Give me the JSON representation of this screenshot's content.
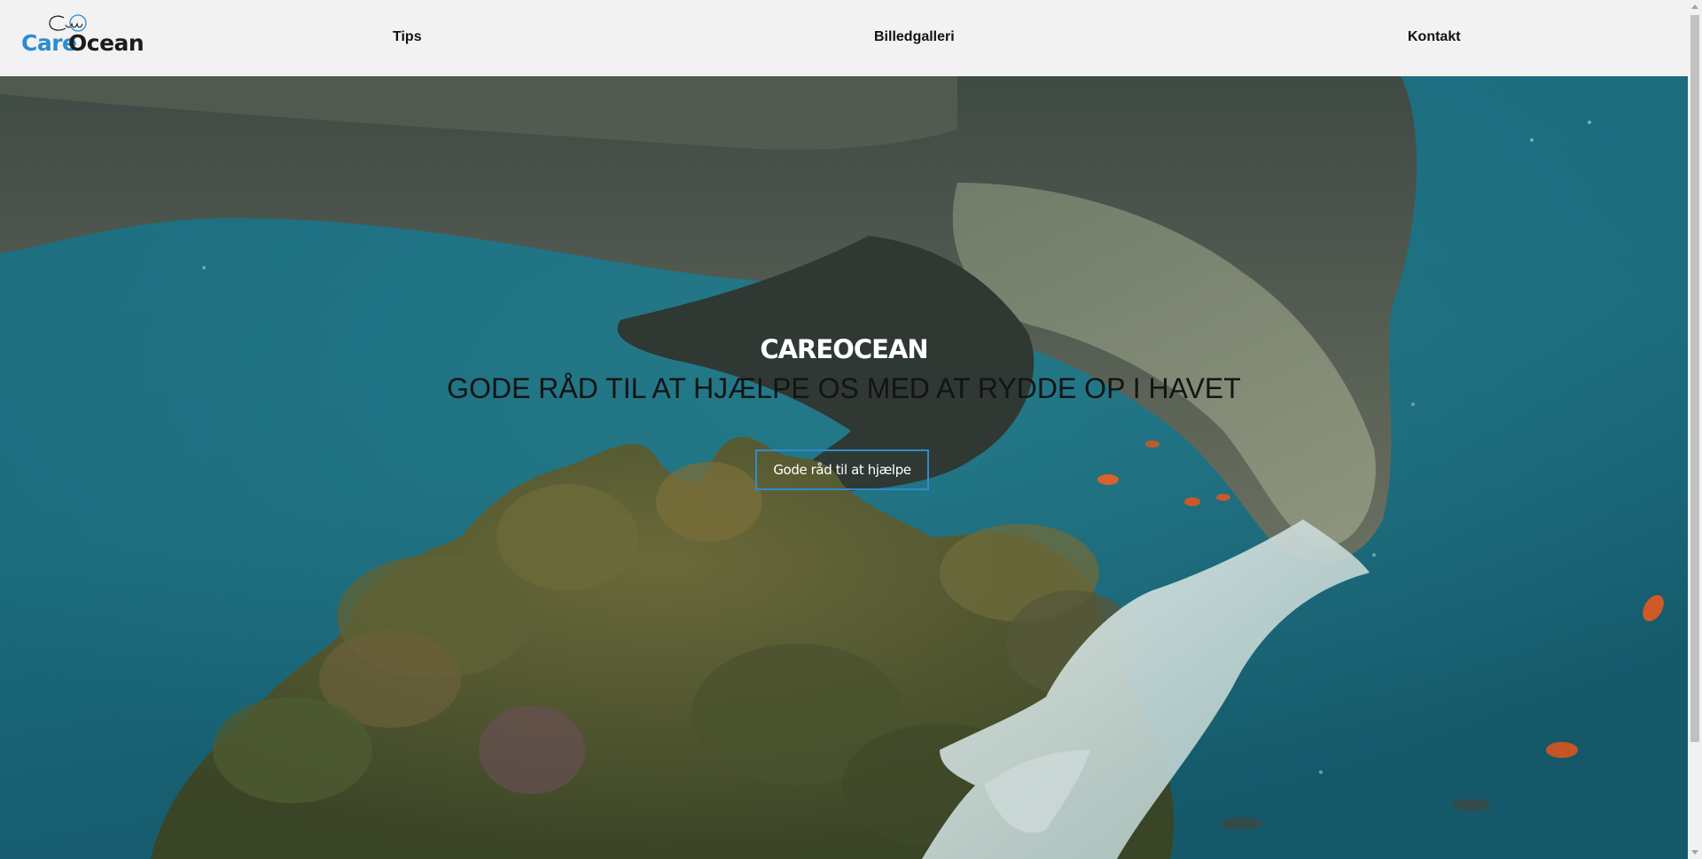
{
  "brand": {
    "logo_care": "Care",
    "logo_ocean": "Ocean",
    "care_color": "#2e8bcf",
    "ocean_color": "#1c1c1c"
  },
  "nav": {
    "items": [
      {
        "label": "Tips"
      },
      {
        "label": "Billedgalleri"
      },
      {
        "label": "Kontakt"
      }
    ]
  },
  "hero": {
    "title": "CAREOCEAN",
    "subtitle": "GODE RÅD TIL AT HJÆLPE OS MED AT RYDDE OP I HAVET",
    "cta_label": "Gode råd til at hjælpe",
    "cta_border_color": "#2e8bcf",
    "background_icon": "underwater-dolphin-plastic-glove-photo"
  }
}
